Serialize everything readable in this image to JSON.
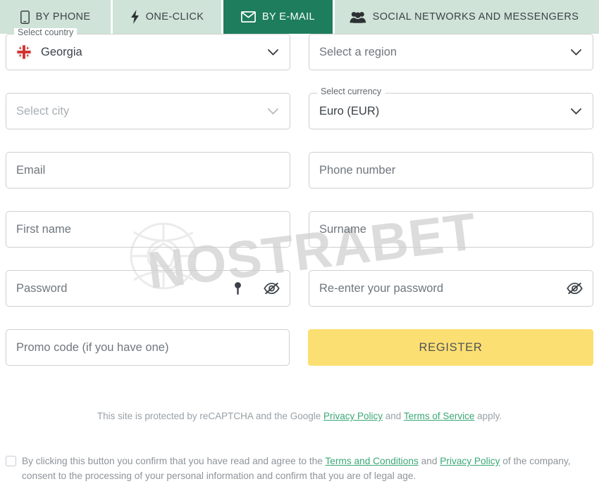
{
  "tabs": [
    {
      "label": "BY PHONE",
      "icon": "phone-icon",
      "active": false
    },
    {
      "label": "ONE-CLICK",
      "icon": "lightning-bolt-icon",
      "active": false
    },
    {
      "label": "BY E-MAIL",
      "icon": "envelope-icon",
      "active": true
    },
    {
      "label": "SOCIAL NETWORKS AND MESSENGERS",
      "icon": "people-group-icon",
      "active": false
    }
  ],
  "fields": {
    "country": {
      "label": "Select country",
      "value": "Georgia",
      "flag": "georgia-flag-icon"
    },
    "region": {
      "placeholder": "Select a region"
    },
    "city": {
      "placeholder": "Select city"
    },
    "currency": {
      "label": "Select currency",
      "value": "Euro (EUR)"
    },
    "email": {
      "placeholder": "Email"
    },
    "phone": {
      "placeholder": "Phone number"
    },
    "first_name": {
      "placeholder": "First name"
    },
    "surname": {
      "placeholder": "Surname"
    },
    "password": {
      "placeholder": "Password"
    },
    "confirm_password": {
      "placeholder": "Re-enter your password"
    },
    "promo": {
      "placeholder": "Promo code (if you have one)"
    }
  },
  "register_button": {
    "label": "REGISTER"
  },
  "recaptcha": {
    "part1": "This site is protected by reCAPTCHA and the Google ",
    "link1": "Privacy Policy",
    "part2": " and ",
    "link2": "Terms of Service",
    "part3": " apply."
  },
  "terms": {
    "part1": "By clicking this button you confirm that you have read and agree to the ",
    "link1": "Terms and Conditions",
    "part2": " and ",
    "link2": "Privacy Policy",
    "part3": " of the company, consent to the processing of your personal information and confirm that you are of legal age."
  },
  "watermark": {
    "text": "NOSTRABET"
  },
  "colors": {
    "tab_inactive_bg": "#cfe3d8",
    "tab_active_bg": "#1e7d5c",
    "register_bg": "#fcdf72",
    "link_green": "#3aa876",
    "border": "#cfcfcf"
  }
}
